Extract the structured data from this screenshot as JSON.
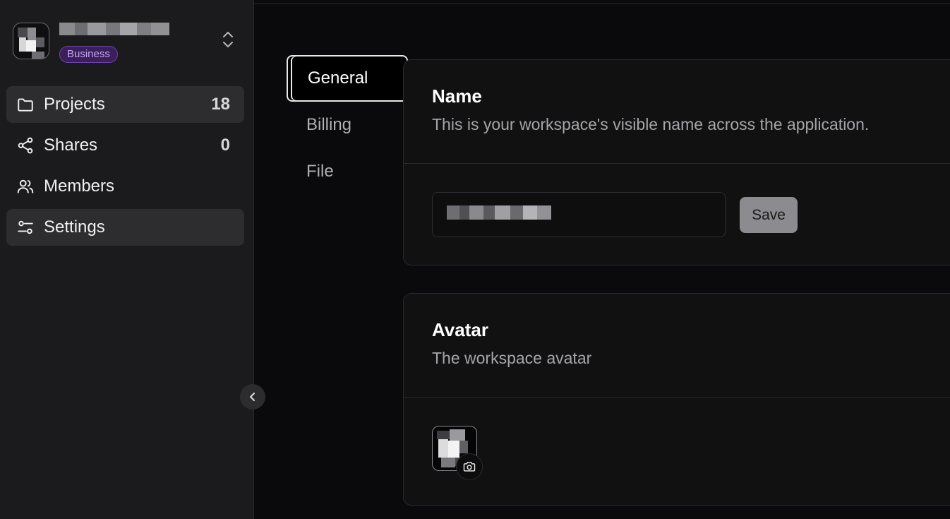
{
  "workspace": {
    "plan_badge": "Business"
  },
  "nav": {
    "items": [
      {
        "label": "Projects",
        "count": "18",
        "icon": "folder-icon",
        "active": true
      },
      {
        "label": "Shares",
        "count": "0",
        "icon": "share-icon",
        "active": false
      },
      {
        "label": "Members",
        "count": "",
        "icon": "users-icon",
        "active": false
      },
      {
        "label": "Settings",
        "count": "",
        "icon": "sliders-icon",
        "active": true
      }
    ]
  },
  "settings_tabs": [
    {
      "label": "General",
      "active": true
    },
    {
      "label": "Billing",
      "active": false
    },
    {
      "label": "File",
      "active": false
    }
  ],
  "name_card": {
    "title": "Name",
    "description": "This is your workspace's visible name across the application.",
    "save_label": "Save"
  },
  "avatar_card": {
    "title": "Avatar",
    "description": "The workspace avatar"
  },
  "colors": {
    "sidebar_bg": "#1b1b1d",
    "main_bg": "#0a0a0c",
    "card_bg": "#111112",
    "badge_bg": "#3a1f5a",
    "badge_text": "#c6a4f2",
    "save_button_bg": "#8c8c90"
  }
}
